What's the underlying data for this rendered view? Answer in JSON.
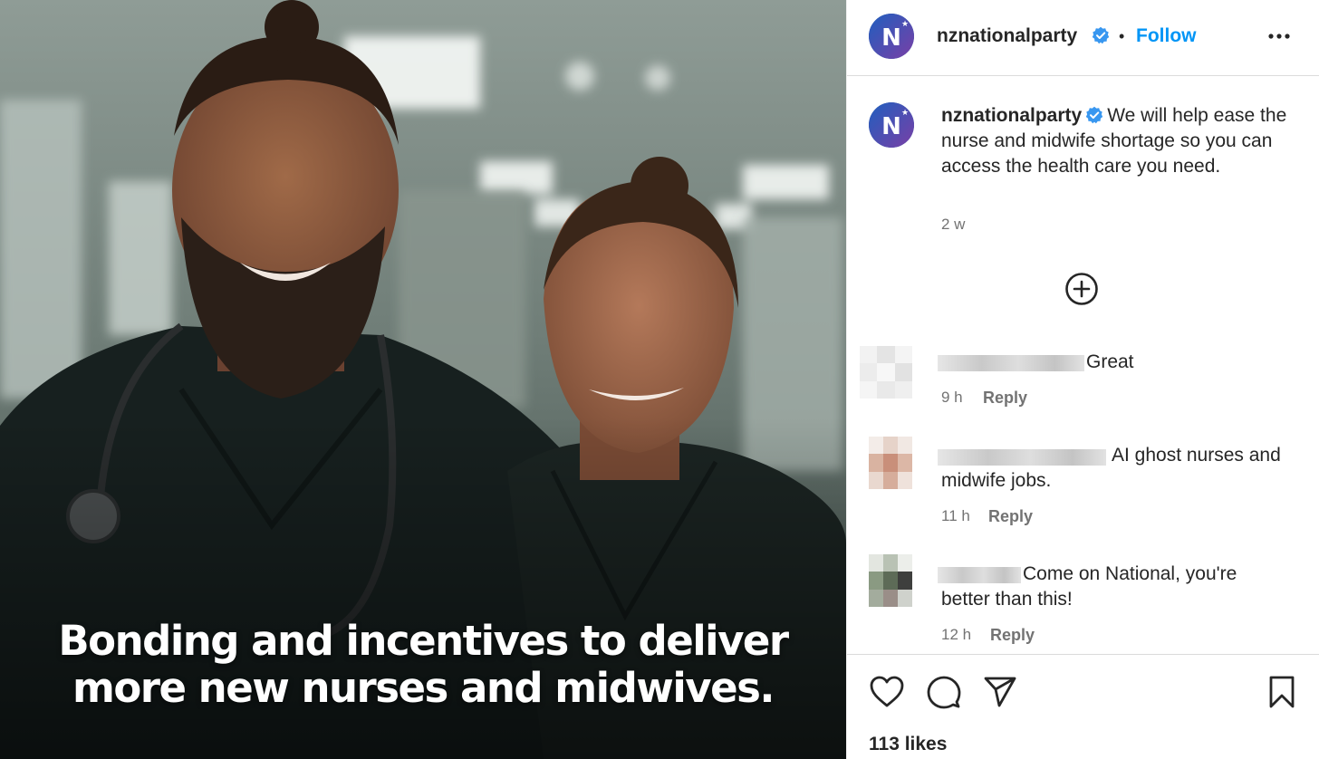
{
  "post": {
    "image_caption_line1": "Bonding and incentives to deliver",
    "image_caption_line2": "more new nurses and midwives."
  },
  "header": {
    "username": "nznationalparty",
    "separator": "•",
    "follow_label": "Follow",
    "more_icon": "more-horizontal-icon"
  },
  "caption": {
    "username": "nznationalparty",
    "text": "We will help ease the nurse and midwife shortage so you can access the health care you need.",
    "time": "2 w"
  },
  "load_more_icon": "plus-circle-icon",
  "comments": [
    {
      "text": "Great",
      "time": "9 h",
      "reply": "Reply"
    },
    {
      "text_line1": "AI ghost nurses and",
      "text_line2": "midwife jobs.",
      "time": "11 h",
      "reply": "Reply"
    },
    {
      "text_line1": "Come on National, you're",
      "text_line2": "better than this!",
      "time": "12 h",
      "reply": "Reply"
    }
  ],
  "actions": {
    "like_icon": "heart-icon",
    "comment_icon": "comment-icon",
    "share_icon": "paper-plane-icon",
    "save_icon": "bookmark-icon"
  },
  "likes": "113 likes",
  "colors": {
    "follow": "#0095f6",
    "verified": "#3897f0",
    "secondary_text": "#737373",
    "avatar_blue": "#1a4a9e",
    "avatar_purple": "#6b3fa0"
  }
}
